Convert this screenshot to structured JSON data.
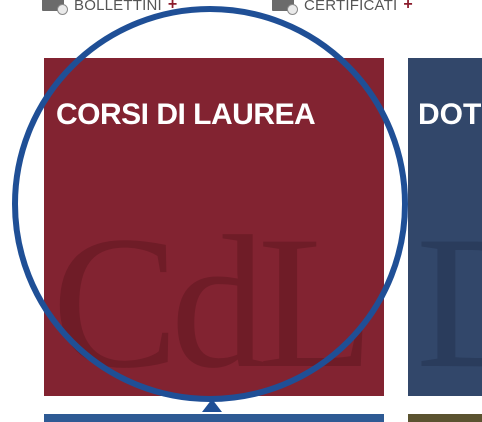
{
  "top_links": {
    "bollettini": {
      "label": "BOLLETTINI",
      "suffix": "+"
    },
    "certificati": {
      "label": "CERTIFICATI",
      "suffix": "+"
    }
  },
  "tiles": {
    "corsi": {
      "title": "CORSI DI LAUREA",
      "watermark": "CdL"
    },
    "dottorati": {
      "title": "DOT",
      "watermark": "D"
    }
  },
  "colors": {
    "corsi_bg": "#822331",
    "dottorati_bg": "#32476a",
    "accent_plus": "#8b1c2c",
    "magnifier": "#1f4f96"
  }
}
